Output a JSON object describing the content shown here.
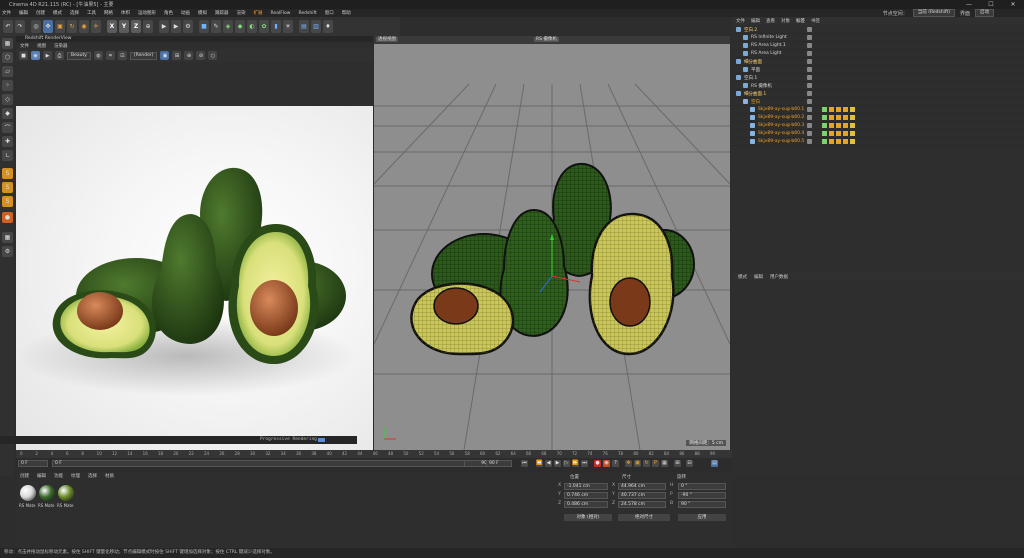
{
  "window": {
    "title": "Cinema 4D R21.115 (RC) - [牛油果5] - 主要",
    "minimize": "—",
    "maximize": "☐",
    "close": "✕"
  },
  "menu": {
    "items": [
      "文件",
      "编辑",
      "创建",
      "模式",
      "选择",
      "工具",
      "网格",
      "体积",
      "运动图形",
      "角色",
      "动画",
      "模拟",
      "跟踪器",
      "渲染",
      "扩展",
      "RealFlow",
      "Redshift",
      "窗口",
      "帮助"
    ],
    "highlight_index": 14,
    "interface_label": "界面",
    "layout_label": "节点空间：",
    "layout_value": "当前 (Redshift)",
    "scheme_label": "启动"
  },
  "toolbar": {
    "axis_x": "X",
    "axis_y": "Y",
    "axis_z": "Z"
  },
  "render_view": {
    "title": "Redshift RenderView",
    "menu": [
      "文件",
      "视图",
      "渲染器"
    ],
    "mode_value": "Beauty",
    "camera_value": "(Render)",
    "status_text": "Progressive Rendering"
  },
  "viewport": {
    "left_tag": "透视视图",
    "center_tag": "RS 摄像机",
    "scale_info": "网格间距：5 cm"
  },
  "object_manager": {
    "tabs": [
      "文件",
      "编辑",
      "查看",
      "对象",
      "标签",
      "书签"
    ],
    "active_tab": 4,
    "rows": [
      {
        "name": "空白.2",
        "level": 0,
        "style": "sel"
      },
      {
        "name": "RS Infinite Light",
        "level": 1,
        "style": ""
      },
      {
        "name": "RS Area Light.1",
        "level": 1,
        "style": ""
      },
      {
        "name": "RS Area Light",
        "level": 1,
        "style": ""
      },
      {
        "name": "细分曲面",
        "level": 0,
        "style": "sel"
      },
      {
        "name": "平面",
        "level": 1,
        "style": ""
      },
      {
        "name": "空白.1",
        "level": 0,
        "style": ""
      },
      {
        "name": "RS 摄像机",
        "level": 1,
        "style": ""
      },
      {
        "name": "细分曲面.1",
        "level": 0,
        "style": "sel"
      },
      {
        "name": "空白",
        "level": 1,
        "style": "or"
      },
      {
        "name": "Skjv89-ay-sug-b60.1",
        "level": 2,
        "style": "or"
      },
      {
        "name": "Skjv89-ay-sug-b60.2",
        "level": 2,
        "style": "or"
      },
      {
        "name": "Skjv89-ay-sug-b60.3",
        "level": 2,
        "style": "or"
      },
      {
        "name": "Skjv89-ay-sug-b60.4",
        "level": 2,
        "style": "or"
      },
      {
        "name": "Skjv89-ay-sug-b60.5",
        "level": 2,
        "style": "or"
      }
    ]
  },
  "attribute_manager": {
    "tabs": [
      "模式",
      "编辑",
      "用户数据"
    ]
  },
  "timeline": {
    "ticks": [
      "0",
      "2",
      "4",
      "6",
      "8",
      "10",
      "12",
      "14",
      "16",
      "18",
      "20",
      "22",
      "24",
      "26",
      "28",
      "30",
      "32",
      "34",
      "36",
      "38",
      "40",
      "42",
      "44",
      "46",
      "48",
      "50",
      "52",
      "54",
      "56",
      "58",
      "60",
      "62",
      "64",
      "66",
      "68",
      "70",
      "72",
      "74",
      "76",
      "78",
      "80",
      "82",
      "84",
      "86",
      "88",
      "90"
    ],
    "current_frame": "0 F",
    "start_frame": "0 F",
    "end_frame": "90 F",
    "max_frame": "90 F",
    "fps_label": "0 F"
  },
  "materials": {
    "menu": [
      "创建",
      "编辑",
      "功能",
      "纹理",
      "选择",
      "材质"
    ],
    "items": [
      {
        "label": "RS Mate",
        "color": "#d8d8d8"
      },
      {
        "label": "RS Mate",
        "color": "#3a6a2a"
      },
      {
        "label": "RS Mate",
        "color": "#6a8a2a"
      }
    ]
  },
  "coordinates": {
    "headers": [
      "位置",
      "尺寸",
      "旋转"
    ],
    "rows": [
      {
        "axis": "X",
        "pos": "-1.041 cm",
        "size": "44.964 cm",
        "rot_axis": "H",
        "rot": "0 °"
      },
      {
        "axis": "Y",
        "pos": "0.746 cm",
        "size": "40.737 cm",
        "rot_axis": "P",
        "rot": "-90 °"
      },
      {
        "axis": "Z",
        "pos": "0.486 cm",
        "size": "24.578 cm",
        "rot_axis": "B",
        "rot": "90 °"
      }
    ],
    "mode_select": "对象 (相对)",
    "size_select": "绝对尺寸",
    "apply_button": "应用"
  },
  "status": {
    "text": "移动：点击并拖动鼠标移动元素。按住 SHIFT 键量化移动；节点编辑模式时按住 SHIFT 键增加选择对象；按住 CTRL 键减少选择对象。"
  },
  "colors": {
    "accent": "#f0a020",
    "selection": "#4a6fa5"
  }
}
